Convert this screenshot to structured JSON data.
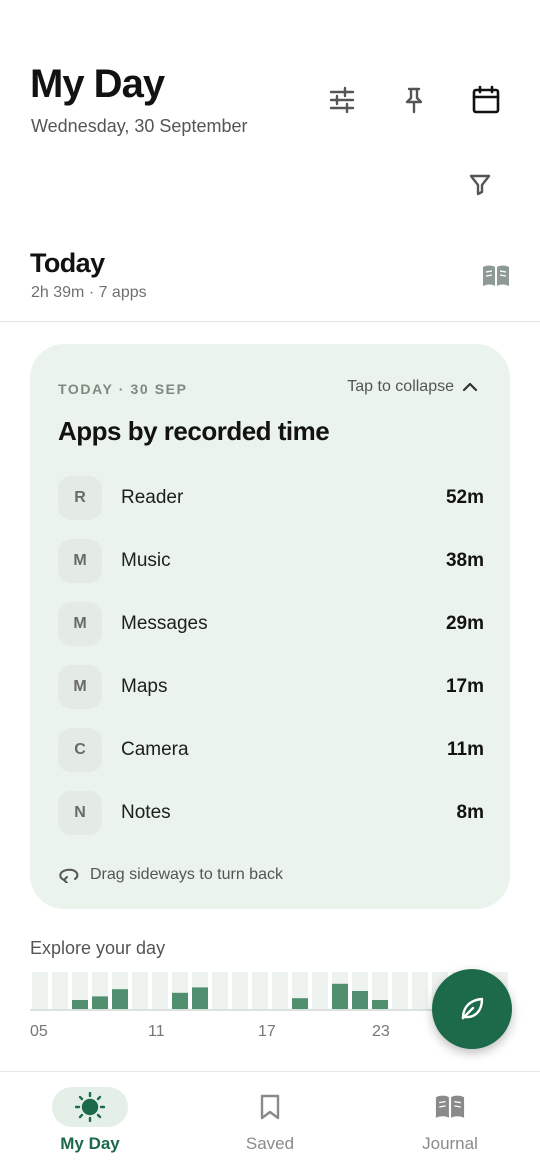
{
  "header": {
    "title": "My Day",
    "date": "Wednesday, 30 September",
    "icons": [
      "sliders-icon",
      "pin-icon",
      "calendar-icon",
      "filter-icon"
    ]
  },
  "today": {
    "title": "Today",
    "summary": "2h 39m · 7 apps",
    "icon": "book-icon"
  },
  "card": {
    "date_label": "TODAY · 30 SEP",
    "collapse_label": "Tap to collapse",
    "heading": "Apps by recorded time",
    "apps": [
      {
        "initial": "R",
        "name": "Reader",
        "time": "52m"
      },
      {
        "initial": "M",
        "name": "Music",
        "time": "38m"
      },
      {
        "initial": "M",
        "name": "Messages",
        "time": "29m"
      },
      {
        "initial": "M",
        "name": "Maps",
        "time": "17m"
      },
      {
        "initial": "C",
        "name": "Camera",
        "time": "11m"
      },
      {
        "initial": "N",
        "name": "Notes",
        "time": "8m"
      }
    ],
    "hint": "Drag sideways to turn back"
  },
  "explore": {
    "label": "Explore your day",
    "hour_values": [
      0,
      0,
      0.25,
      0.35,
      0.55,
      0,
      0,
      0.45,
      0.6,
      0,
      0,
      0,
      0,
      0.3,
      0,
      0.7,
      0.5,
      0.25,
      0,
      0,
      0,
      0,
      0,
      0,
      0
    ],
    "tick_labels": [
      "05",
      "11",
      "17",
      "23"
    ],
    "colors": {
      "slot": "#eef2ef",
      "bar": "#4f8e6e",
      "base": "#d9e2dc"
    }
  },
  "fab": {
    "icon": "leaf-icon",
    "color": "#1c6a4a"
  },
  "nav": {
    "items": [
      {
        "label": "My Day",
        "icon": "sun-icon",
        "active": true
      },
      {
        "label": "Saved",
        "icon": "bookmark-icon",
        "active": false
      },
      {
        "label": "Journal",
        "icon": "book-icon",
        "active": false
      }
    ]
  },
  "colors": {
    "accent": "#1c6a4a",
    "card_bg": "#eaf3ec"
  }
}
